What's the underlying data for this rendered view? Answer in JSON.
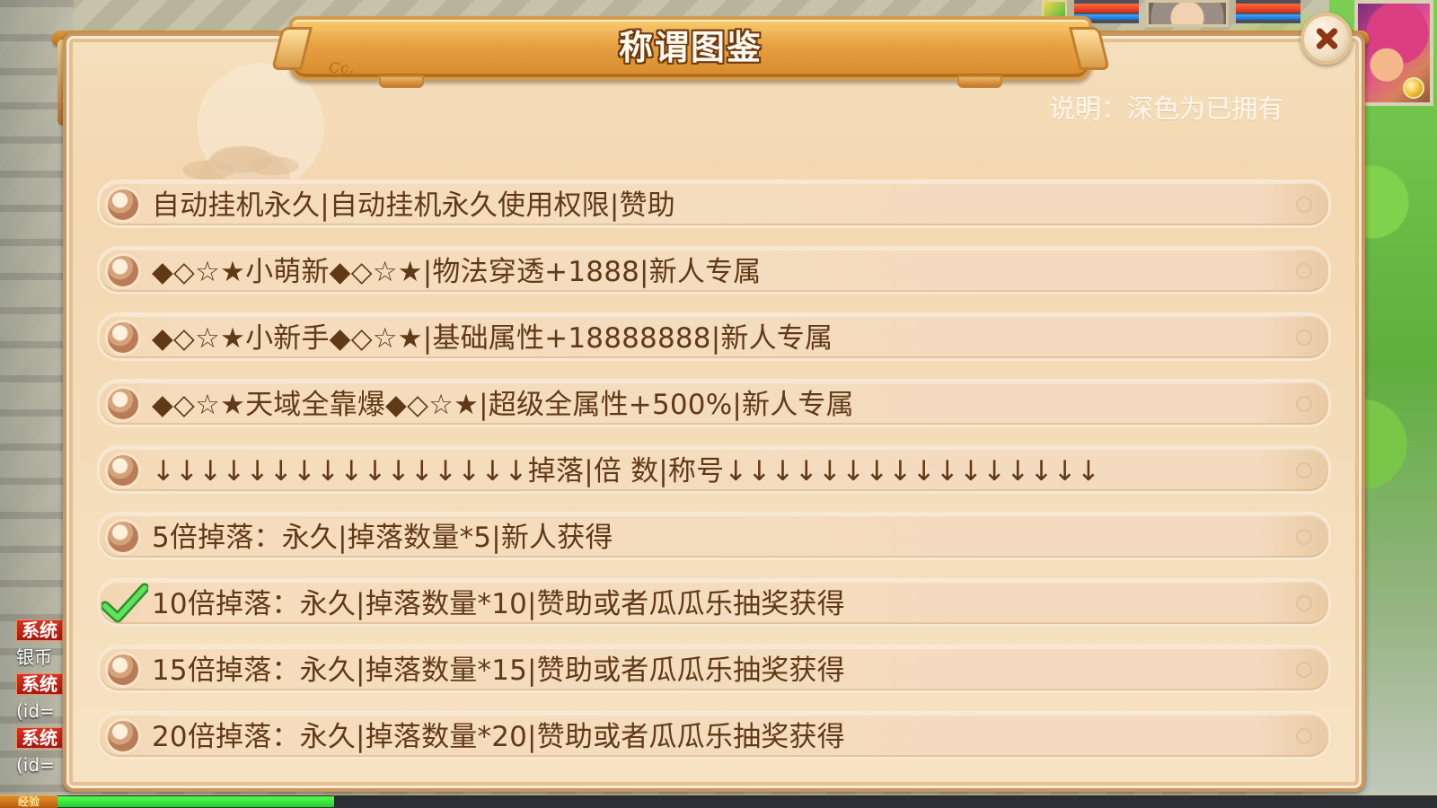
{
  "window": {
    "title": "称谓图鉴",
    "close_label": "×"
  },
  "legend": {
    "text": "说明：深色为已拥有"
  },
  "titles": [
    {
      "text": "自动挂机永久|自动挂机永久使用权限|赞助",
      "owned": false
    },
    {
      "text": "◆◇☆★小萌新◆◇☆★|物法穿透+1888|新人专属",
      "owned": false
    },
    {
      "text": "◆◇☆★小新手◆◇☆★|基础属性+18888888|新人专属",
      "owned": false
    },
    {
      "text": "◆◇☆★天域全靠爆◆◇☆★|超级全属性+500%|新人专属",
      "owned": false
    },
    {
      "text": "↓↓↓↓↓↓↓↓↓↓↓↓↓↓↓↓掉落|倍 数|称号↓↓↓↓↓↓↓↓↓↓↓↓↓↓↓↓",
      "owned": false
    },
    {
      "text": "5倍掉落：永久|掉落数量*5|新人获得",
      "owned": false
    },
    {
      "text": "10倍掉落：永久|掉落数量*10|赞助或者瓜瓜乐抽奖获得",
      "owned": true
    },
    {
      "text": "15倍掉落：永久|掉落数量*15|赞助或者瓜瓜乐抽奖获得",
      "owned": false
    },
    {
      "text": "20倍掉落：永久|掉落数量*20|赞助或者瓜瓜乐抽奖获得",
      "owned": false
    }
  ],
  "background": {
    "chat_labels": [
      "系统",
      "系统",
      "系统"
    ],
    "chat_lines": [
      "银币",
      "(id=",
      "(id="
    ],
    "exp_label": "经验"
  },
  "icons": {
    "close": "close-icon",
    "unowned": "circle-marker-icon",
    "owned": "check-icon"
  },
  "colors": {
    "panel": "#f5dfbc",
    "banner": "#e6a042",
    "text": "#603a17",
    "owned_check": "#43c548"
  }
}
